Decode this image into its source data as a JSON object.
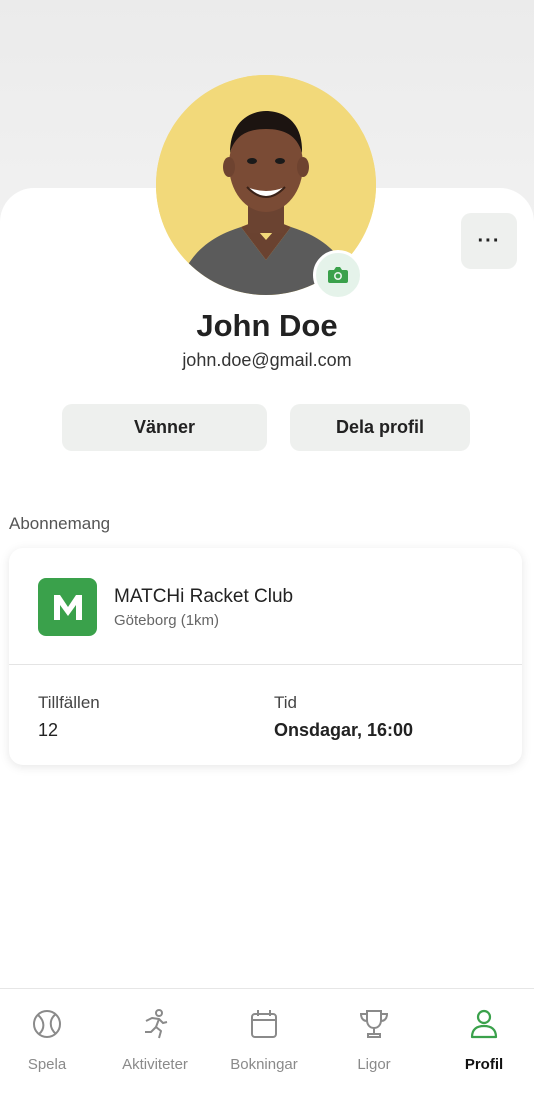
{
  "profile": {
    "name": "John Doe",
    "email": "john.doe@gmail.com",
    "avatar_bg": "#f2d97a"
  },
  "actions": {
    "more_label": "···",
    "friends_label": "Vänner",
    "share_label": "Dela profil"
  },
  "subscription": {
    "section_title": "Abonnemang",
    "club_logo_letter": "M",
    "club_name": "MATCHi Racket Club",
    "club_location": "Göteborg (1km)",
    "sessions_label": "Tillfällen",
    "sessions_value": "12",
    "time_label": "Tid",
    "time_value": "Onsdagar, 16:00"
  },
  "tabs": [
    {
      "label": "Spela",
      "icon": "tennis-ball-icon",
      "active": false
    },
    {
      "label": "Aktiviteter",
      "icon": "running-person-icon",
      "active": false
    },
    {
      "label": "Bokningar",
      "icon": "calendar-icon",
      "active": false
    },
    {
      "label": "Ligor",
      "icon": "trophy-icon",
      "active": false
    },
    {
      "label": "Profil",
      "icon": "user-icon",
      "active": true
    }
  ],
  "colors": {
    "accent": "#3aa14b",
    "inactive": "#8a8a8a"
  }
}
